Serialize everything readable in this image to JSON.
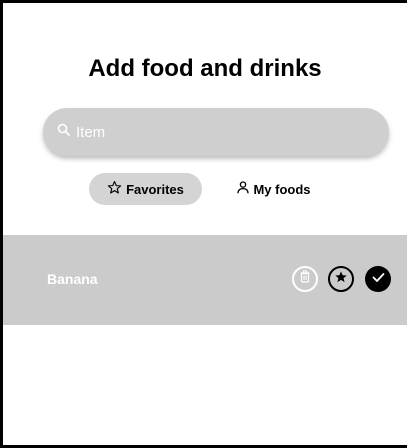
{
  "header": {
    "title": "Add food and drinks"
  },
  "search": {
    "placeholder": "Item",
    "value": "",
    "icon": "search-icon"
  },
  "tabs": [
    {
      "label": "Favorites",
      "icon": "star-outline-icon",
      "selected": true
    },
    {
      "label": "My foods",
      "icon": "person-icon",
      "selected": false
    }
  ],
  "items": [
    {
      "label": "Banana",
      "actions": [
        "delete-icon",
        "star-filled-icon",
        "check-icon"
      ]
    }
  ],
  "colors": {
    "row_background": "#cbcbcb",
    "search_background": "#cfcfcf",
    "selected_tab_background": "#d4d4d4"
  }
}
